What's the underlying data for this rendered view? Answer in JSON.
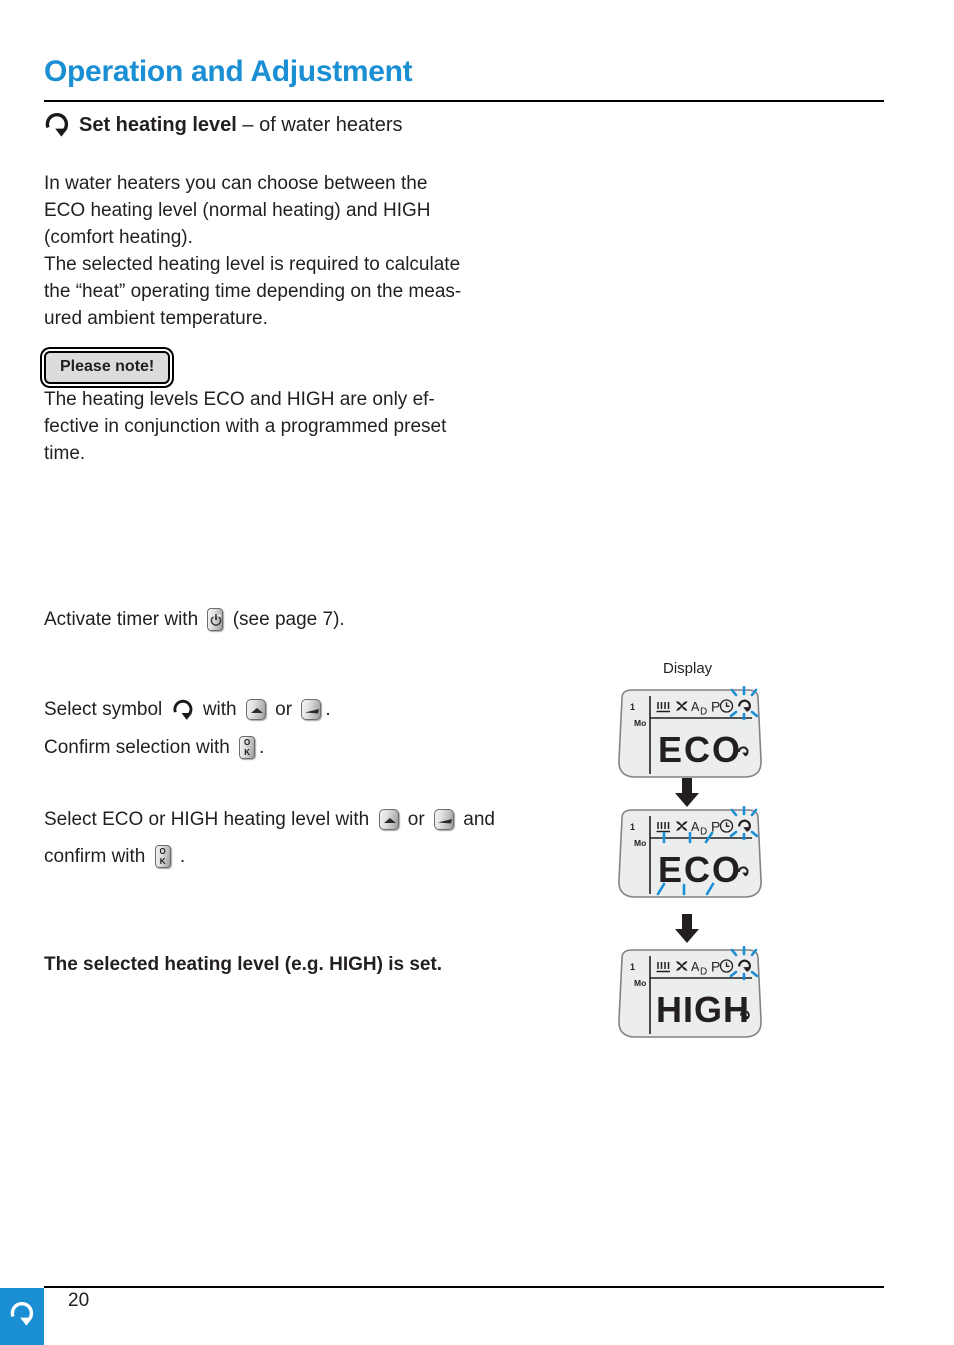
{
  "header": {
    "title": "Operation and Adjustment",
    "subheading_bold": "Set heating level",
    "subheading_light": " – of water heaters",
    "icon": "rotation-arrow-icon"
  },
  "intro": {
    "text": "In water heaters you can choose between the\nECO heating level (normal heating) and HIGH\n(comfort heating).\nThe selected heating level is required to calculate\nthe “heat” operating time depending on the meas-\nured ambient temperature."
  },
  "note": {
    "badge_label": "Please note!",
    "text": "The heating levels ECO and HIGH are only ef-\nfective in conjunction with a programmed preset\ntime."
  },
  "steps": {
    "activate": {
      "part1": "Activate timer with ",
      "key1": "power-button",
      "part2": " (see page 7)."
    },
    "select_symbol": {
      "part1": "Select symbol ",
      "symbol": "rotation-arrow-icon",
      "part2": " with ",
      "key1": "up-arrow-button",
      "part3": " or ",
      "key2": "down-arrow-button",
      "part4": "."
    },
    "confirm": {
      "part1": "Confirm selection with ",
      "key1": "ok-button",
      "part2": "."
    },
    "select_level": {
      "part1": "Select ECO or HIGH heating level with ",
      "key1": "up-arrow-button",
      "part2": " or ",
      "key2": "down-arrow-button",
      "part3": " and"
    },
    "confirm2": {
      "part1": "confirm with ",
      "key1": "ok-button",
      "part2": " ."
    },
    "result": "The selected heating level (e.g. HIGH) is set."
  },
  "display_panel": {
    "label": "Display",
    "screens": [
      {
        "id": "display-eco-symbol-selected",
        "channel": "1",
        "weekday": "Mo",
        "status_icons": [
          "heater-icon",
          "fan-icon",
          "auto-day-icon",
          "program-icon",
          "clock-icon",
          "rotation-arrow-icon"
        ],
        "main_text": "ECO",
        "corner_symbol": "rotation-arrow-icon",
        "blink_targets": [
          "rotation-arrow-icon"
        ]
      },
      {
        "id": "display-eco-value-blinking",
        "channel": "1",
        "weekday": "Mo",
        "status_icons": [
          "heater-icon",
          "fan-icon",
          "auto-day-icon",
          "program-icon",
          "clock-icon",
          "rotation-arrow-icon"
        ],
        "main_text": "ECO",
        "corner_symbol": "rotation-arrow-icon",
        "blink_targets": [
          "rotation-arrow-icon",
          "main-text"
        ]
      },
      {
        "id": "display-high-set",
        "channel": "1",
        "weekday": "Mo",
        "status_icons": [
          "heater-icon",
          "fan-icon",
          "auto-day-icon",
          "program-icon",
          "clock-icon",
          "rotation-arrow-icon"
        ],
        "main_text": "HIGH",
        "corner_symbol": "rotation-arrow-icon",
        "blink_targets": [
          "rotation-arrow-icon"
        ]
      }
    ],
    "status_icon_labels": {
      "auto_day": "AD",
      "program": "P"
    }
  },
  "footer": {
    "page_number": "20",
    "tab_icon": "rotation-arrow-icon"
  },
  "colors": {
    "brand_blue": "#1a8fd4",
    "text": "#231f20",
    "blink_blue": "#1a8fd4",
    "lcd_body": "#eceded"
  }
}
